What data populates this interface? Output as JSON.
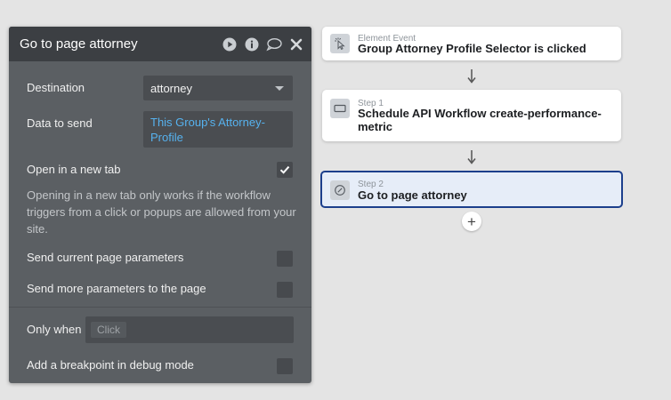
{
  "panel": {
    "title": "Go to page attorney",
    "destination_label": "Destination",
    "destination_value": "attorney",
    "data_to_send_label": "Data to send",
    "data_to_send_value": "This Group's Attorney-Profile",
    "open_new_tab_label": "Open in a new tab",
    "open_new_tab_checked": true,
    "new_tab_hint": "Opening in a new tab only works if the workflow triggers from a click or popups are allowed from your site.",
    "send_current_params_label": "Send current page parameters",
    "send_current_params_checked": false,
    "send_more_params_label": "Send more parameters to the page",
    "send_more_params_checked": false,
    "only_when_label": "Only when",
    "only_when_placeholder": "Click",
    "breakpoint_label": "Add a breakpoint in debug mode",
    "breakpoint_checked": false
  },
  "workflow": {
    "event": {
      "kind": "Element Event",
      "name": "Group Attorney Profile Selector is clicked",
      "icon": "pointer-click-icon"
    },
    "steps": [
      {
        "kind": "Step 1",
        "name": "Schedule API Workflow create-performance-metric",
        "icon": "api-workflow-icon",
        "selected": false
      },
      {
        "kind": "Step 2",
        "name": "Go to page attorney",
        "icon": "navigate-icon",
        "selected": true
      }
    ],
    "add_label": "+"
  },
  "colors": {
    "panel_bg": "#5b5f63",
    "panel_header": "#3c3f43",
    "dynamic_text": "#56b2ef",
    "selected_border": "#1c3f8c",
    "selected_bg": "#e6edf8"
  }
}
